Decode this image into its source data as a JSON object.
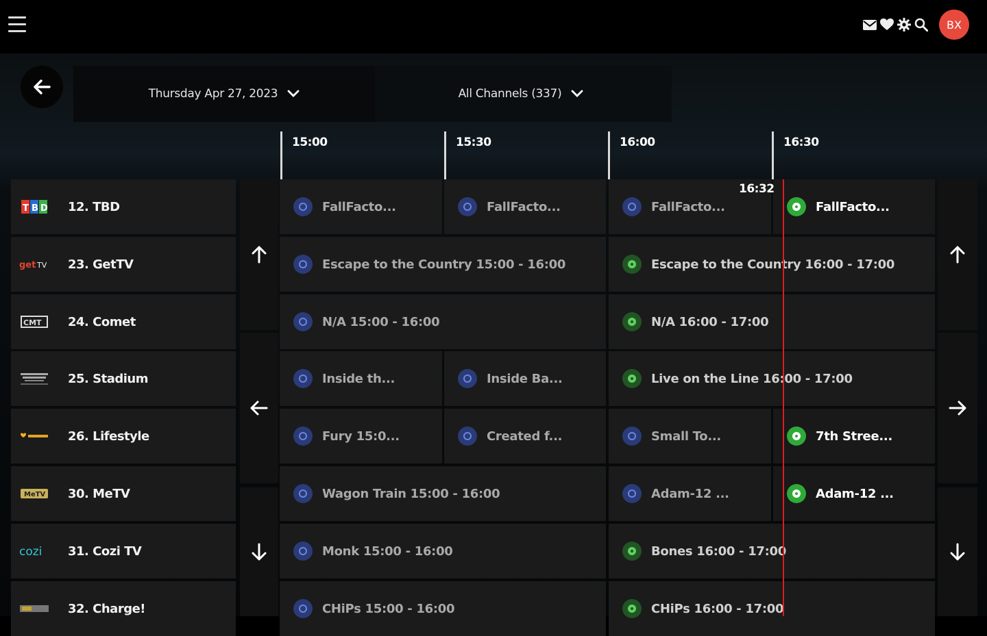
{
  "header": {
    "avatar_initials": "BX",
    "icons": [
      "mail-icon",
      "heart-icon",
      "gear-icon",
      "search-icon"
    ]
  },
  "filters": {
    "date_label": "Thursday Apr 27, 2023",
    "channels_label": "All Channels (337)"
  },
  "timeline": {
    "ticks": [
      "15:00",
      "15:30",
      "16:00",
      "16:30"
    ],
    "now_label": "16:32"
  },
  "channels": [
    {
      "name": "12. TBD",
      "logo": "tbd-logo"
    },
    {
      "name": "23. GetTV",
      "logo": "gettv-logo"
    },
    {
      "name": "24. Comet",
      "logo": "comet-logo"
    },
    {
      "name": "25. Stadium",
      "logo": "stadium-logo"
    },
    {
      "name": "26. Lifestyle",
      "logo": "lifestyle-logo"
    },
    {
      "name": "30. MeTV",
      "logo": "metv-logo"
    },
    {
      "name": "31. Cozi TV",
      "logo": "cozi-logo"
    },
    {
      "name": "32. Charge!",
      "logo": "charge-logo"
    }
  ],
  "programs": [
    [
      {
        "title": "FallFacto...",
        "state": "past"
      },
      {
        "title": "FallFacto...",
        "state": "past"
      },
      {
        "title": "FallFacto...",
        "state": "past"
      },
      {
        "title": "FallFacto...",
        "state": "next"
      }
    ],
    [
      {
        "title": "Escape to the Country 15:00 - 16:00",
        "state": "past"
      },
      {
        "title": "Escape to the Country 16:00 - 17:00",
        "state": "now"
      }
    ],
    [
      {
        "title": "N/A 15:00 - 16:00",
        "state": "past"
      },
      {
        "title": "N/A 16:00 - 17:00",
        "state": "now"
      }
    ],
    [
      {
        "title": "Inside th...",
        "state": "past"
      },
      {
        "title": "Inside Ba...",
        "state": "past"
      },
      {
        "title": "Live on the Line 16:00 - 17:00",
        "state": "now"
      }
    ],
    [
      {
        "title": "Fury 15:0...",
        "state": "past"
      },
      {
        "title": "Created f...",
        "state": "past"
      },
      {
        "title": "Small To...",
        "state": "past"
      },
      {
        "title": "7th Stree...",
        "state": "next"
      }
    ],
    [
      {
        "title": "Wagon Train 15:00 - 16:00",
        "state": "past"
      },
      {
        "title": "Adam-12 ...",
        "state": "past"
      },
      {
        "title": "Adam-12 ...",
        "state": "next"
      }
    ],
    [
      {
        "title": "Monk 15:00 - 16:00",
        "state": "past"
      },
      {
        "title": "Bones 16:00 - 17:00",
        "state": "now"
      }
    ],
    [
      {
        "title": "CHiPs 15:00 - 16:00",
        "state": "past"
      },
      {
        "title": "CHiPs 16:00 - 17:00",
        "state": "now"
      }
    ]
  ],
  "colors": {
    "accent_red": "#e01c1c",
    "avatar": "#e8493d",
    "past_icon": "#2a3b78",
    "now_icon": "#215524",
    "next_icon": "#2faa38"
  }
}
